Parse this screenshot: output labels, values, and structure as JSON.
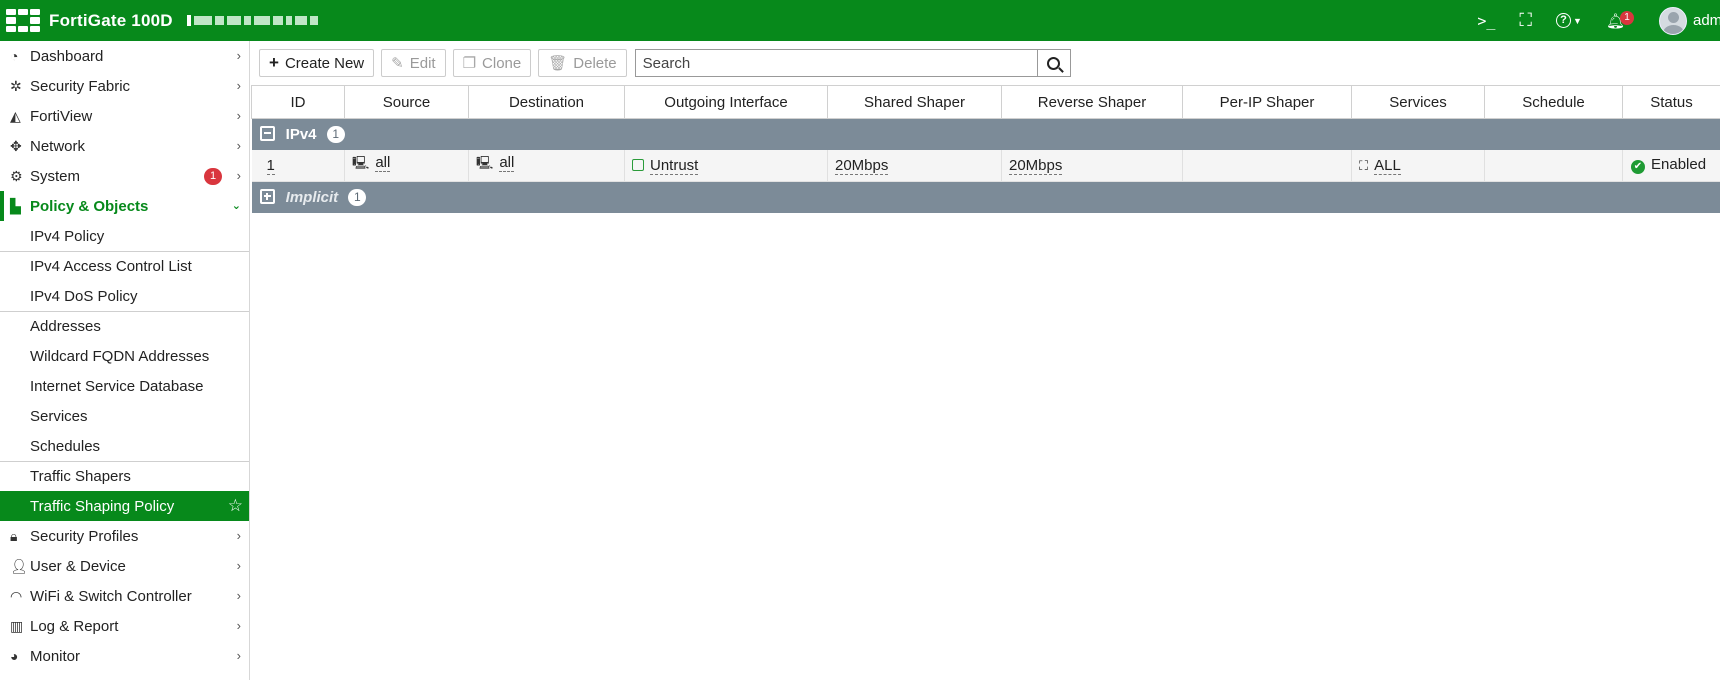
{
  "header": {
    "title": "FortiGate 100D",
    "user": "admin",
    "notification_count": "1"
  },
  "sidebar": {
    "items": [
      {
        "label": "Dashboard",
        "icon": "dashboard-icon"
      },
      {
        "label": "Security Fabric",
        "icon": "fabric-icon"
      },
      {
        "label": "FortiView",
        "icon": "chart-icon"
      },
      {
        "label": "Network",
        "icon": "network-icon"
      },
      {
        "label": "System",
        "icon": "gear-icon",
        "badge": "1"
      },
      {
        "label": "Policy & Objects",
        "icon": "policy-icon"
      }
    ],
    "policy_sub": [
      "IPv4 Policy",
      "IPv4 Access Control List",
      "IPv4 DoS Policy",
      "Addresses",
      "Wildcard FQDN Addresses",
      "Internet Service Database",
      "Services",
      "Schedules",
      "Traffic Shapers",
      "Traffic Shaping Policy"
    ],
    "bottom_items": [
      {
        "label": "Security Profiles",
        "icon": "lock-icon"
      },
      {
        "label": "User & Device",
        "icon": "user-icon"
      },
      {
        "label": "WiFi & Switch Controller",
        "icon": "wifi-icon"
      },
      {
        "label": "Log & Report",
        "icon": "bar-chart-icon"
      },
      {
        "label": "Monitor",
        "icon": "pie-icon"
      }
    ]
  },
  "toolbar": {
    "create_label": "Create New",
    "edit_label": "Edit",
    "clone_label": "Clone",
    "delete_label": "Delete",
    "search_placeholder": "Search"
  },
  "table": {
    "columns": [
      "ID",
      "Source",
      "Destination",
      "Outgoing Interface",
      "Shared Shaper",
      "Reverse Shaper",
      "Per-IP Shaper",
      "Services",
      "Schedule",
      "Status"
    ],
    "groups": [
      {
        "name": "IPv4",
        "count": "1",
        "rows": [
          {
            "id": "1",
            "source": "all",
            "destination": "all",
            "interface": "Untrust",
            "shared_shaper": "20Mbps",
            "reverse_shaper": "20Mbps",
            "per_ip_shaper": "",
            "services": "ALL",
            "schedule": "",
            "status": "Enabled"
          }
        ]
      },
      {
        "name": "Implicit",
        "count": "1"
      }
    ]
  },
  "colors": {
    "accent": "#07891b",
    "group_row": "#7c8b98",
    "badge": "#d9363e"
  }
}
